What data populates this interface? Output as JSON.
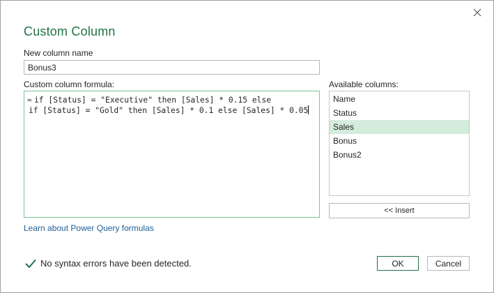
{
  "dialog": {
    "title": "Custom Column",
    "close_icon": "close-icon"
  },
  "name_field": {
    "label": "New column name",
    "value": "Bonus3"
  },
  "formula": {
    "label": "Custom column formula:",
    "prefix": "=",
    "line1": "if [Status] = \"Executive\" then [Sales] * 0.15 else",
    "line2": "if [Status] = \"Gold\" then [Sales] * 0.1 else [Sales] * 0.05"
  },
  "available_columns": {
    "label": "Available columns:",
    "items": [
      {
        "label": "Name"
      },
      {
        "label": "Status"
      },
      {
        "label": "Sales"
      },
      {
        "label": "Bonus"
      },
      {
        "label": "Bonus2"
      }
    ],
    "selected_index": 2,
    "insert_label": "<< Insert"
  },
  "learn_link": "Learn about Power Query formulas",
  "status": {
    "text": "No syntax errors have been detected.",
    "icon": "checkmark-icon"
  },
  "buttons": {
    "ok": "OK",
    "cancel": "Cancel"
  },
  "colors": {
    "accent": "#217346",
    "selection": "#d3ecdc",
    "link": "#1d5f97"
  }
}
